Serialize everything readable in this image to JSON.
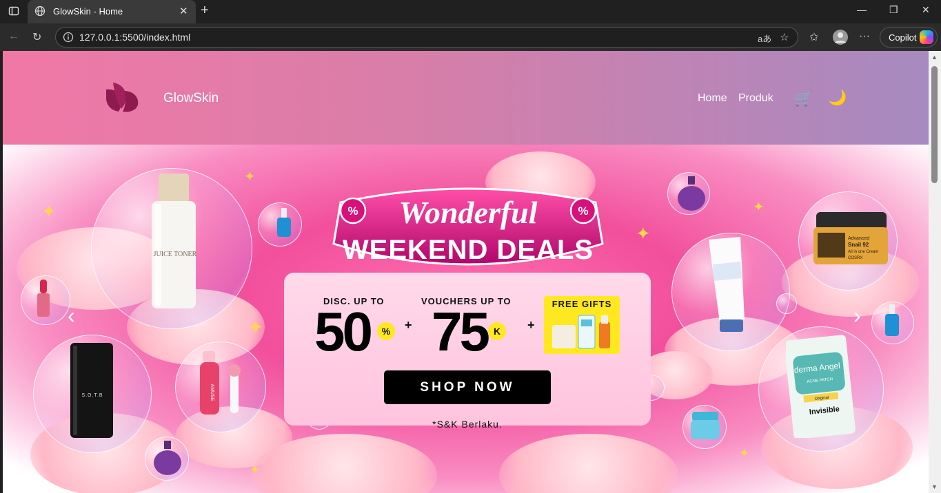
{
  "browser": {
    "tab_title": "GlowSkin - Home",
    "address_url": "127.0.0.1:5500/index.html",
    "copilot_label": "Copilot"
  },
  "header": {
    "brand": "GlowSkin",
    "nav": [
      "Home",
      "Produk"
    ],
    "gradient": [
      "#f178a6",
      "#a68ac0"
    ]
  },
  "banner": {
    "headline_script": "Wonderful",
    "headline_main": "WEEKEND DEALS",
    "disc_label": "DISC. UP TO",
    "disc_value": "50",
    "disc_unit": "%",
    "voucher_label": "VOUCHERS UP TO",
    "voucher_value": "75",
    "voucher_unit": "K",
    "plus": "+",
    "gifts_label": "FREE GIFTS",
    "cta": "SHOP NOW",
    "terms": "*S&K Berlaku.",
    "accent": "#ff2d8a"
  },
  "products": {
    "toner_text": "JUICE TONER",
    "tint_brand": "AMUSE",
    "perfume_text": "S.O.T.B",
    "patch_brand": "derma Angel",
    "patch_sub": "ACNE PATCH",
    "patch_tag": "Original",
    "patch_word": "Invisible",
    "snail_lines": [
      "Advanced",
      "Snail 92",
      "All in one Cream",
      "COSRX"
    ]
  }
}
